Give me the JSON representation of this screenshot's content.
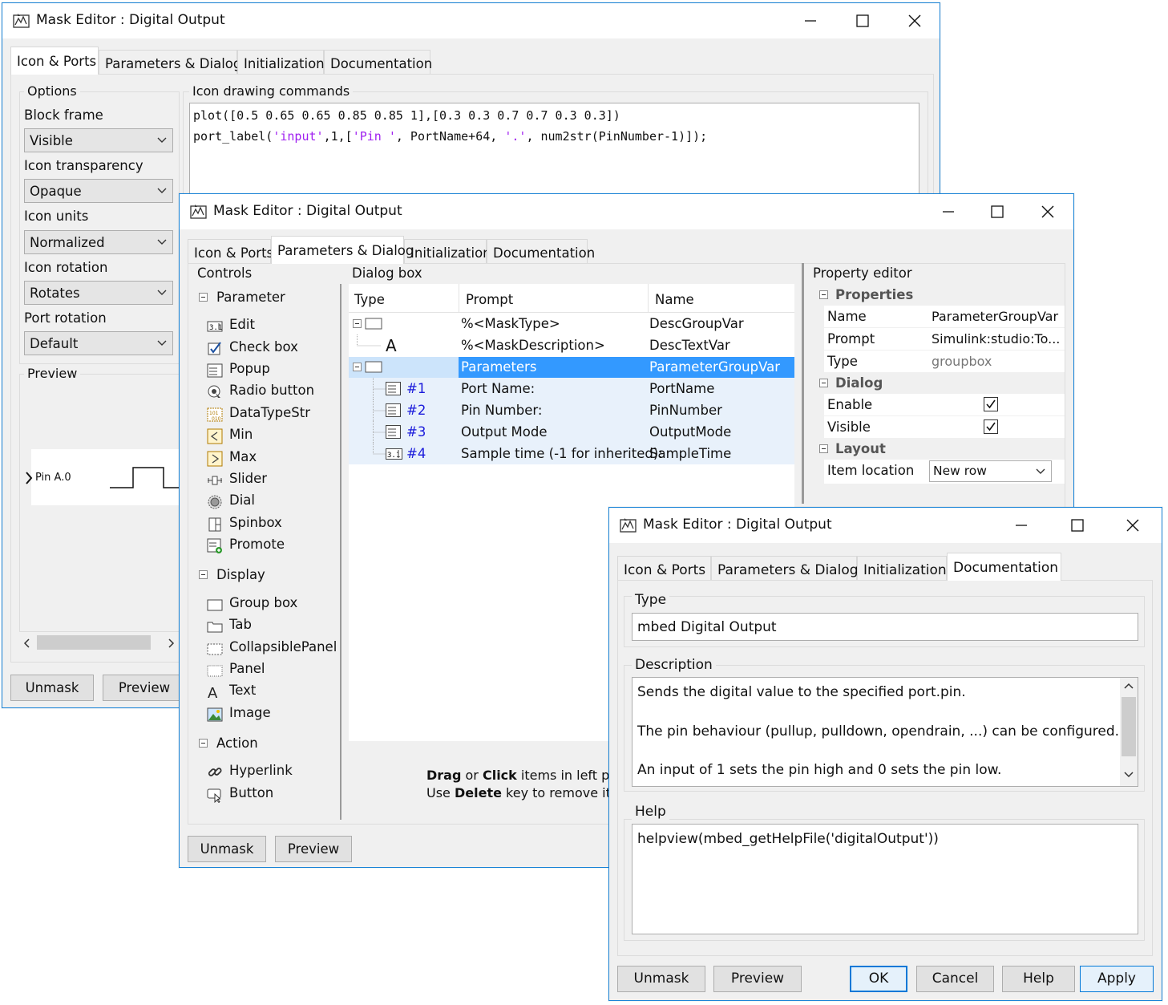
{
  "win1": {
    "title": "Mask Editor : Digital Output",
    "tabs": [
      "Icon & Ports",
      "Parameters & Dialog",
      "Initialization",
      "Documentation"
    ],
    "options": {
      "group_label": "Options",
      "block_frame_label": "Block frame",
      "block_frame_value": "Visible",
      "icon_transparency_label": "Icon transparency",
      "icon_transparency_value": "Opaque",
      "icon_units_label": "Icon units",
      "icon_units_value": "Normalized",
      "icon_rotation_label": "Icon rotation",
      "icon_rotation_value": "Rotates",
      "port_rotation_label": "Port rotation",
      "port_rotation_value": "Default"
    },
    "preview": {
      "group_label": "Preview",
      "port_label": "Pin A.0"
    },
    "commands": {
      "group_label": "Icon drawing commands",
      "line1": "plot([0.5 0.65 0.65 0.85 0.85 1],[0.3 0.3 0.7 0.7 0.3 0.3])",
      "line2_a": "port_label(",
      "line2_b": "'input'",
      "line2_c": ",1,[",
      "line2_d": "'Pin '",
      "line2_e": ", PortName+64, ",
      "line2_f": "'.'",
      "line2_g": ", num2str(PinNumber-1)]);"
    },
    "buttons": {
      "unmask": "Unmask",
      "preview": "Preview"
    }
  },
  "win2": {
    "title": "Mask Editor : Digital Output",
    "tabs": [
      "Icon & Ports",
      "Parameters & Dialog",
      "Initialization",
      "Documentation"
    ],
    "controls": {
      "label": "Controls",
      "parameter_cat": "Parameter",
      "parameter_items": [
        "Edit",
        "Check box",
        "Popup",
        "Radio button",
        "DataTypeStr",
        "Min",
        "Max",
        "Slider",
        "Dial",
        "Spinbox",
        "Promote"
      ],
      "display_cat": "Display",
      "display_items": [
        "Group box",
        "Tab",
        "CollapsiblePanel",
        "Panel",
        "Text",
        "Image"
      ],
      "action_cat": "Action",
      "action_items": [
        "Hyperlink",
        "Button"
      ]
    },
    "dialog_box": {
      "label": "Dialog box",
      "columns": [
        "Type",
        "Prompt",
        "Name"
      ],
      "rows": [
        {
          "num": "",
          "prompt": "%<MaskType>",
          "name": "DescGroupVar"
        },
        {
          "num": "",
          "prompt": "%<MaskDescription>",
          "name": "DescTextVar"
        },
        {
          "num": "",
          "prompt": "Parameters",
          "name": "ParameterGroupVar"
        },
        {
          "num": "#1",
          "prompt": "Port Name:",
          "name": "PortName"
        },
        {
          "num": "#2",
          "prompt": "Pin Number:",
          "name": "PinNumber"
        },
        {
          "num": "#3",
          "prompt": "Output Mode",
          "name": "OutputMode"
        },
        {
          "num": "#4",
          "prompt": "Sample time (-1 for inherited):",
          "name": "SampleTime"
        }
      ],
      "hint1_a": "Drag",
      "hint1_b": " or ",
      "hint1_c": "Click",
      "hint1_d": " items in left palet",
      "hint2_a": "Use ",
      "hint2_b": "Delete",
      "hint2_c": " key to remove item"
    },
    "property_editor": {
      "label": "Property editor",
      "properties_head": "Properties",
      "name_k": "Name",
      "name_v": "ParameterGroupVar",
      "prompt_k": "Prompt",
      "prompt_v": "Simulink:studio:To...",
      "type_k": "Type",
      "type_v": "groupbox",
      "dialog_head": "Dialog",
      "enable_k": "Enable",
      "enable_checked": true,
      "visible_k": "Visible",
      "visible_checked": true,
      "layout_head": "Layout",
      "item_location_k": "Item location",
      "item_location_v": "New row"
    },
    "buttons": {
      "unmask": "Unmask",
      "preview": "Preview"
    },
    "colors": {
      "selection": "#3399ff",
      "row_tint": "#e8f1fb",
      "number_link": "#1a1adb"
    }
  },
  "win3": {
    "title": "Mask Editor : Digital Output",
    "tabs": [
      "Icon & Ports",
      "Parameters & Dialog",
      "Initialization",
      "Documentation"
    ],
    "type_label": "Type",
    "type_value": "mbed Digital Output",
    "description_label": "Description",
    "description_lines": [
      "Sends the digital value to the specified port.pin.",
      "The pin behaviour (pullup, pulldown, opendrain, ...) can be configured.",
      "An input of 1 sets the pin high and 0 sets the pin low."
    ],
    "help_label": "Help",
    "help_value": "helpview(mbed_getHelpFile('digitalOutput'))",
    "buttons": {
      "unmask": "Unmask",
      "preview": "Preview",
      "ok": "OK",
      "cancel": "Cancel",
      "help": "Help",
      "apply": "Apply"
    }
  }
}
